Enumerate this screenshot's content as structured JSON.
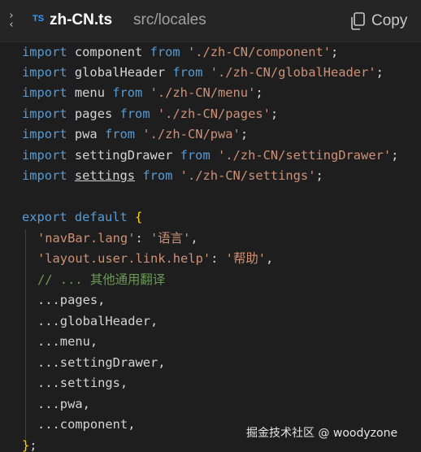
{
  "header": {
    "collapse_glyph": "›‹",
    "language_badge": "TS",
    "file_name": "zh-CN.ts",
    "file_path": "src/locales",
    "copy_label": "Copy",
    "copy_icon": "copy-icon"
  },
  "code": {
    "l1": {
      "k": "import",
      "i": "component",
      "f": "from",
      "s": "'./zh-CN/component'",
      "p": ";"
    },
    "l2": {
      "k": "import",
      "i": "globalHeader",
      "f": "from",
      "s": "'./zh-CN/globalHeader'",
      "p": ";"
    },
    "l3": {
      "k": "import",
      "i": "menu",
      "f": "from",
      "s": "'./zh-CN/menu'",
      "p": ";"
    },
    "l4": {
      "k": "import",
      "i": "pages",
      "f": "from",
      "s": "'./zh-CN/pages'",
      "p": ";"
    },
    "l5": {
      "k": "import",
      "i": "pwa",
      "f": "from",
      "s": "'./zh-CN/pwa'",
      "p": ";"
    },
    "l6": {
      "k": "import",
      "i": "settingDrawer",
      "f": "from",
      "s": "'./zh-CN/settingDrawer'",
      "p": ";"
    },
    "l7": {
      "k": "import",
      "i": "settings",
      "f": "from",
      "s": "'./zh-CN/settings'",
      "p": ";"
    },
    "l9": {
      "k1": "export",
      "k2": "default",
      "b": "{"
    },
    "l10": {
      "key": "'navBar.lang'",
      "sep": ": ",
      "val": "'语言'",
      "p": ","
    },
    "l11": {
      "key": "'layout.user.link.help'",
      "sep": ": ",
      "val": "'帮助'",
      "p": ","
    },
    "l12": {
      "comment": "// ... 其他通用翻译"
    },
    "spreads": [
      "...pages,",
      "...globalHeader,",
      "...menu,",
      "...settingDrawer,",
      "...settings,",
      "...pwa,",
      "...component,"
    ],
    "l20": {
      "b": "}",
      "p": ";"
    }
  },
  "watermark": "掘金技术社区 @ woodyzone",
  "colors": {
    "background": "#1e1e1e",
    "header_bg": "#252526",
    "keyword": "#569cd6",
    "string": "#ce9178",
    "comment": "#6a9955",
    "bracket": "#ffd700",
    "ts_badge": "#3b9cf5"
  }
}
